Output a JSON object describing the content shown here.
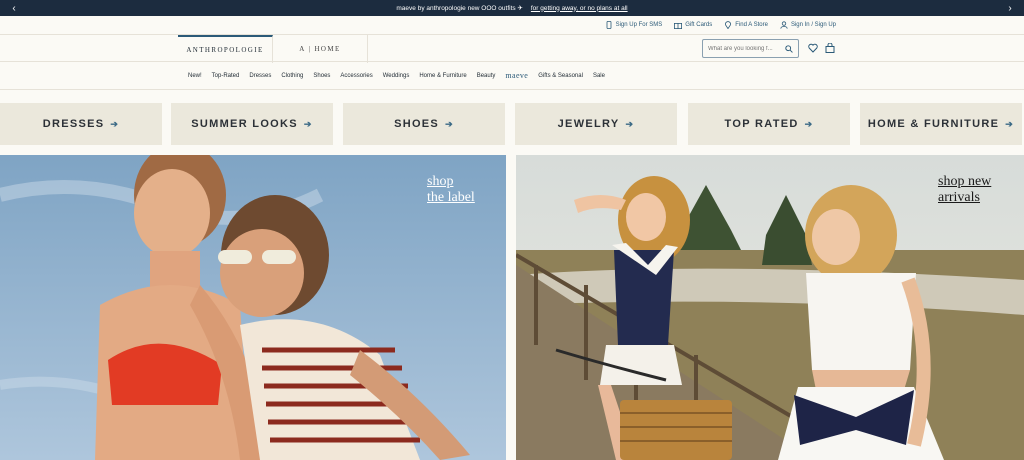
{
  "promo": {
    "text": "maeve by anthropologie new OOO outfits ✈",
    "link": "for getting away, or no plans at all",
    "prev_icon": "chevron-left-icon",
    "next_icon": "chevron-right-icon"
  },
  "utility": {
    "items": [
      {
        "label": "Sign Up For SMS",
        "icon": "phone-icon"
      },
      {
        "label": "Gift Cards",
        "icon": "gift-icon"
      },
      {
        "label": "Find A Store",
        "icon": "location-pin-icon"
      },
      {
        "label": "Sign In / Sign Up",
        "icon": "user-icon"
      }
    ]
  },
  "brand": {
    "tabs": [
      "ANTHROPOLOGIE",
      "A | HOME"
    ]
  },
  "search": {
    "placeholder": "What are you looking f..."
  },
  "nav": {
    "items": [
      "New!",
      "Top-Rated",
      "Dresses",
      "Clothing",
      "Shoes",
      "Accessories",
      "Weddings",
      "Home & Furniture",
      "Beauty",
      "maeve",
      "Gifts & Seasonal",
      "Sale"
    ]
  },
  "categories": [
    "DRESSES",
    "SUMMER LOOKS",
    "SHOES",
    "JEWELRY",
    "TOP RATED",
    "HOME & FURNITURE"
  ],
  "heroes": {
    "left_cta_line1": "shop",
    "left_cta_line2": "the label",
    "right_cta_line1": "shop new",
    "right_cta_line2": "arrivals"
  },
  "colors": {
    "promo_bg": "#1c2c3f",
    "accent": "#2b5a78",
    "tile_bg": "#ebe8dc"
  }
}
